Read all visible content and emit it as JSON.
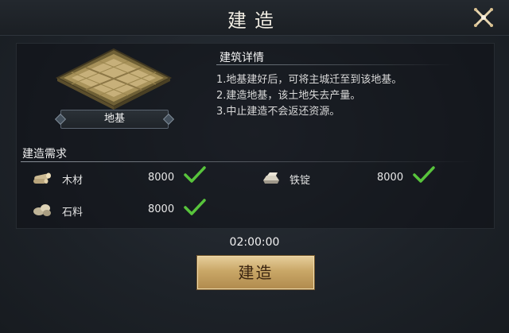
{
  "window": {
    "title": "建造"
  },
  "building": {
    "name": "地基"
  },
  "details": {
    "title": "建筑详情",
    "lines": [
      "1.地基建好后，可将主城迁至到该地基。",
      "2.建造地基，该土地失去产量。",
      "3.中止建造不会返还资源。"
    ]
  },
  "requirements": {
    "title": "建造需求",
    "items": [
      {
        "label": "木材",
        "amount": "8000",
        "icon": "wood-icon",
        "met": true
      },
      {
        "label": "铁锭",
        "amount": "8000",
        "icon": "iron-ingot-icon",
        "met": true
      },
      {
        "label": "石料",
        "amount": "8000",
        "icon": "stone-icon",
        "met": true
      }
    ]
  },
  "timer": "02:00:00",
  "build_button": "建造",
  "colors": {
    "accent_gold": "#c9a767",
    "check_green": "#58c43c"
  }
}
